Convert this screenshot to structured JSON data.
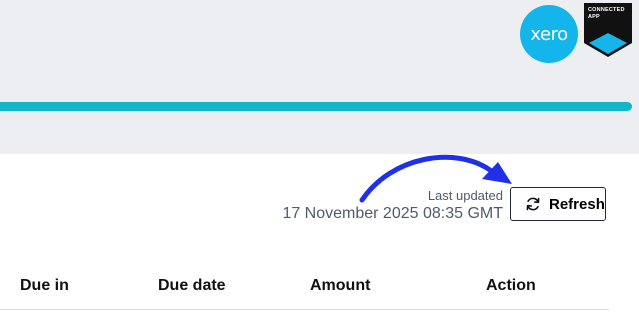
{
  "branding": {
    "xero_logo_text": "xero",
    "badge_line1": "CONNECTED",
    "badge_line2": "APP"
  },
  "status": {
    "last_updated_label": "Last updated",
    "last_updated_value": "17 November 2025 08:35 GMT"
  },
  "toolbar": {
    "refresh_label": "Refresh"
  },
  "table": {
    "columns": [
      "Due in",
      "Due date",
      "Amount",
      "Action"
    ]
  },
  "colors": {
    "accent_teal": "#13b5c8",
    "xero_blue": "#13b5ea",
    "annotation_arrow": "#2030e8",
    "header_background": "#edeef2"
  }
}
